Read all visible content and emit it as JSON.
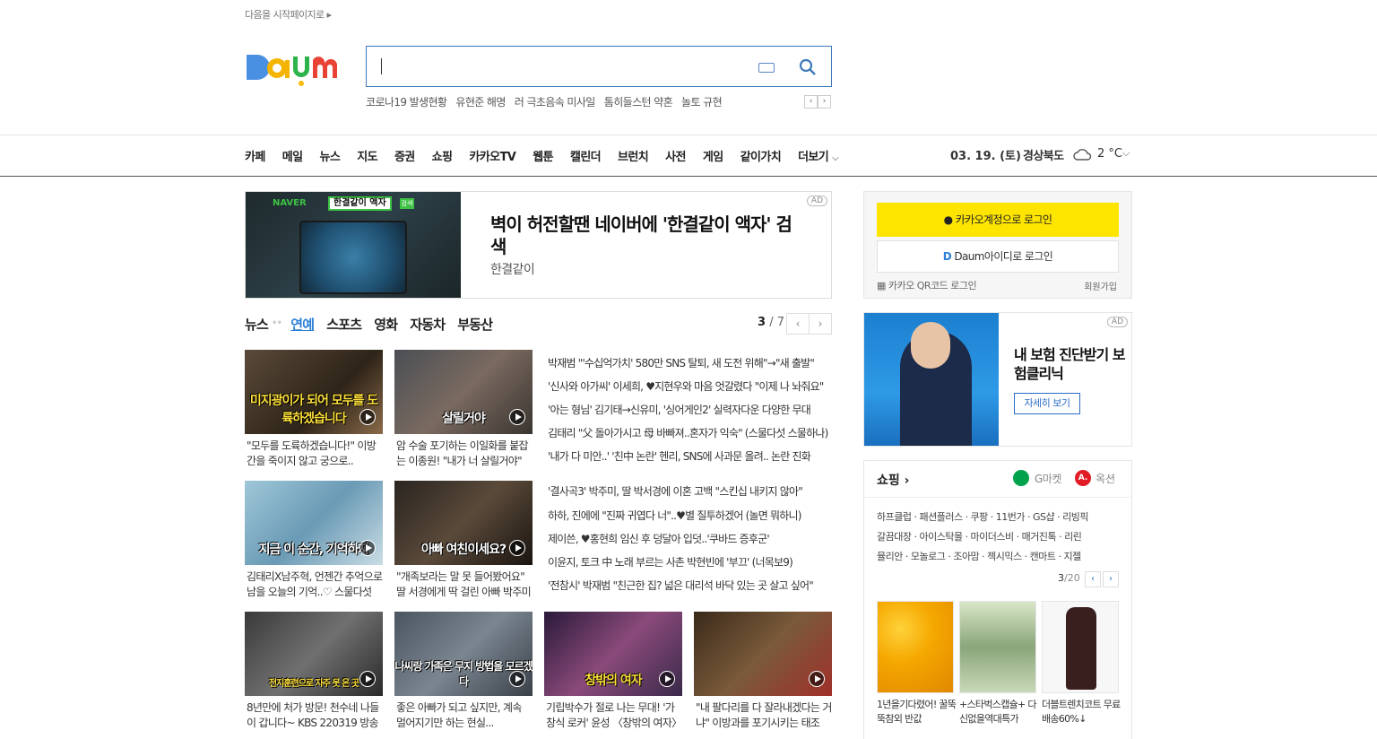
{
  "header": {
    "start_page": "다음을 시작페이지로",
    "logo_text": "Daum",
    "search_placeholder": "",
    "trending": [
      "코로나19 발생현황",
      "유현준 해명",
      "러 극초음속 미사일",
      "톰히들스턴 약혼",
      "놀토 규현"
    ]
  },
  "gnb": {
    "items": [
      "카페",
      "메일",
      "뉴스",
      "지도",
      "증권",
      "쇼핑",
      "카카오TV",
      "웹툰",
      "캘린더",
      "브런치",
      "사전",
      "게임",
      "같이가치",
      "더보기"
    ],
    "date": "03. 19. (토)",
    "region": "경상북도",
    "temp": "2 °C"
  },
  "ad_main": {
    "naver": "NAVER",
    "naver_label": "한결같이 액자",
    "naver_btn": "검색",
    "title": "벽이 허전할땐 네이버에 '한결같이 액자' 검색",
    "sub": "한결같이",
    "badge": "AD"
  },
  "news": {
    "tabs": [
      "뉴스",
      "연예",
      "스포츠",
      "영화",
      "자동차",
      "부동산"
    ],
    "page_current": "3",
    "page_total": "/ 7",
    "thumbs": [
      {
        "caption": "미지광이가 되어 모두를 도륙하겠습니다",
        "title": "\"모두를 도륙하겠습니다!\" 이방간을 죽이지 않고 궁으로.."
      },
      {
        "caption": "살릴거야",
        "title": "암 수술 포기하는 이일화를 붙잡는 이종원! \"내가 너 살릴거야\""
      },
      {
        "caption": "지금 이 순간, 기억하자",
        "title": "김태리X남주혁, 언젠간 추억으로 남을 오늘의 기억..♡ 스물다섯"
      },
      {
        "caption": "아빠 여친이세요?",
        "title": "\"개족보라는 말 못 들어봤어요\" 딸 서경에게 딱 걸린 아빠 박주미"
      },
      {
        "caption": "전지훈련으로 자주 못 온 곳",
        "title": "8년만에 처가 방문! 천수네 나들이 갑니다~ KBS 220319 방송"
      },
      {
        "caption": "나씨랑 가족은 무지 방법을 모르겠다",
        "title": "좋은 아빠가 되고 싶지만, 계속 멀어지기만 하는 현실..."
      },
      {
        "caption": "창밖의 여자",
        "title": "기립박수가 절로 나는 무대! '가창식 로커' 윤성 〈창밖의 여자〉"
      },
      {
        "caption": "",
        "title": "\"내 팔다리를 다 잘라내겠다는 거냐\" 이방과를 포기시키는 태조"
      }
    ],
    "headlines": [
      "박재범 \"'수십억가치' 580만 SNS 탈퇴, 새 도전 위해\"→\"새 출발\"",
      "'신사와 아가씨' 이세희, ♥지현우와 마음 엇갈렸다 \"이제 나 놔줘요\"",
      "'아는 형님' 김기태→신유미, '싱어게인2' 실력자다운 다양한 무대",
      "김태리 \"父 돌아가시고 母 바빠져..혼자가 익숙\" (스물다섯 스물하나)",
      "'내가 다 미안..' '친中 논란' 헨리, SNS에 사과문 올려.. 논란 진화",
      "'결사곡3' 박주미, 딸 박서경에 이혼 고백 \"스킨십 내키지 않아\"",
      "하하, 진에에 \"진짜 귀엽다 너\"..♥별 질투하겠어 (놀면 뭐하니)",
      "제이쓴, ♥홍현희 임신 후 덩달아 입덧..'쿠바드 증후군'",
      "이윤지, 토크 中 노래 부르는 사촌 박현빈에 '부끄' (너목보9)",
      "'전참시' 박재범 \"친근한 집? 넓은 대리석 바닥 있는 곳 살고 싶어\""
    ]
  },
  "login": {
    "kakao": "카카오계정으로 로그인",
    "daum": "Daum아이디로 로그인",
    "qr": "카카오 QR코드 로그인",
    "signup": "회원가입"
  },
  "ad_side": {
    "title": "내 보험 진단받기 보험클리닉",
    "button": "자세히 보기",
    "badge": "AD"
  },
  "shopping": {
    "title": "쇼핑",
    "gmarket": "G마켓",
    "auction_icon": "A.",
    "auction": "옥션",
    "lines": [
      "하프클럽 · 패션플러스 · 쿠팡 · 11번가 · GS샵 · 리빙픽",
      "갈끔대장 · 아이스탁몰 · 마이더스비 · 매거진톡 · 리린",
      "뮬리안 · 모놀로그 · 조아맘 · 젝시믹스 · 캔마트 · 지젤"
    ],
    "page_current": "3",
    "page_total": "/20",
    "items": [
      "1년을기다렸어! 꿀뚝뚝참외 반값",
      "+스타벅스캡슐+ 다신없을역대특가",
      "더블트렌치코트 무료배송60%↓"
    ]
  },
  "colors": {
    "accent": "#2a7fd7",
    "kakao_yellow": "#fee500",
    "search_border": "#3d7ab8"
  }
}
